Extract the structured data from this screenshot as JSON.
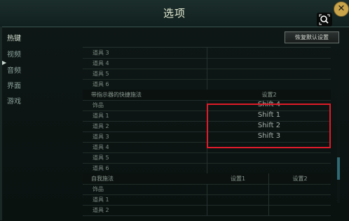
{
  "window": {
    "title": "选项",
    "close_glyph": "✕"
  },
  "sidebar": {
    "items": [
      {
        "label": "热键",
        "active": true
      },
      {
        "label": "视频",
        "active": false
      },
      {
        "label": "音频",
        "active": false
      },
      {
        "label": "界面",
        "active": false
      },
      {
        "label": "游戏",
        "active": false
      }
    ]
  },
  "toolbar": {
    "reset_label": "恢复默认设置"
  },
  "table": {
    "rows": [
      {
        "name": "道具 3",
        "value": ""
      },
      {
        "name": "道具 4",
        "value": ""
      },
      {
        "name": "道具 5",
        "value": ""
      },
      {
        "name": "道具 6",
        "value": ""
      },
      {
        "name": "带指示器的快捷施法",
        "section": true,
        "setting1": "设置2"
      },
      {
        "name": "饰品",
        "value": "Shift 4"
      },
      {
        "name": "道具 1",
        "value": "Shift 1"
      },
      {
        "name": "道具 2",
        "value": "Shift 2"
      },
      {
        "name": "道具 3",
        "value": "Shift 3"
      },
      {
        "name": "道具 4",
        "value": ""
      },
      {
        "name": "道具 5",
        "value": ""
      },
      {
        "name": "道具 6",
        "value": ""
      },
      {
        "name": "自我施法",
        "section": true,
        "setting1": "设置1",
        "setting2": "设置2"
      },
      {
        "name": "饰品",
        "value": ""
      },
      {
        "name": "道具 1",
        "value": ""
      },
      {
        "name": "道具 2",
        "value": ""
      }
    ]
  },
  "colors": {
    "highlight": "#e01b2a",
    "accent": "#2f6a75"
  }
}
